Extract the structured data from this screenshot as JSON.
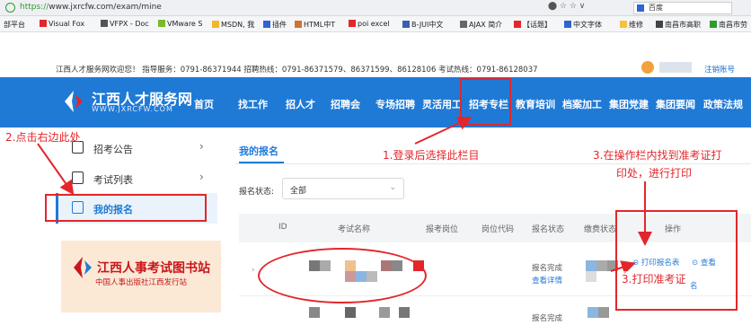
{
  "browser": {
    "url_scheme": "https://",
    "url_rest": "www.jxrcfw.com/exam/mine",
    "toolbar_icons": "⬤ ☆ ☆ ∨",
    "search_engine": "百度"
  },
  "bookmarks": [
    "部平台",
    "Visual Fox",
    "VFPX - Doc",
    "VMware S",
    "MSDN, 我",
    "插件",
    "HTML中T",
    "poi excel",
    "B-JUI中文",
    "AJAX 简介",
    "【话题】",
    "中文字体",
    "维修",
    "南昌市高职",
    "南昌市劳"
  ],
  "info_bar": {
    "text": "江西人才服务网欢迎您！ 指导服务：0791-86371944 招聘热线：0791-86371579、86371599、86128106 考试热线：0791-86128037",
    "logout": "注销账号"
  },
  "site": {
    "name": "江西人才服务网",
    "domain": "WWW.JXRCFW.COM"
  },
  "nav": [
    "首页",
    "找工作",
    "招人才",
    "招聘会",
    "专场招聘",
    "灵活用工",
    "招考专栏",
    "教育培训",
    "档案加工",
    "集团党建",
    "集团要闻",
    "政策法规"
  ],
  "sidebar": {
    "items": [
      {
        "label": "招考公告",
        "icon": "notice-icon"
      },
      {
        "label": "考试列表",
        "icon": "list-icon"
      },
      {
        "label": "我的报名",
        "icon": "check-icon"
      }
    ],
    "banner_title": "江西人事考试图书站",
    "banner_sub": "中国人事出版社江西发行站"
  },
  "main": {
    "tab": "我的报名",
    "filter_label": "报名状态:",
    "filter_value": "全部",
    "columns": [
      "ID",
      "考试名称",
      "报考岗位",
      "岗位代码",
      "报名状态",
      "缴费状态",
      "操作"
    ],
    "row1": {
      "status": "报名完成",
      "view_details": "查看详情",
      "print_form": "打印报名表",
      "view": "查看",
      "extra": "名"
    },
    "row2": {
      "status": "报名完成"
    }
  },
  "annotations": {
    "step1": "1.登录后选择此栏目",
    "step2": "2.点击右边此处",
    "step3a": "3.在操作栏内找到准考证打",
    "step3b": "印处，进行打印",
    "step3c": "3.打印准考证"
  },
  "colors": {
    "primary": "#1f7ad6",
    "annotation_red": "#e3262b",
    "banner_red": "#c9161c"
  }
}
